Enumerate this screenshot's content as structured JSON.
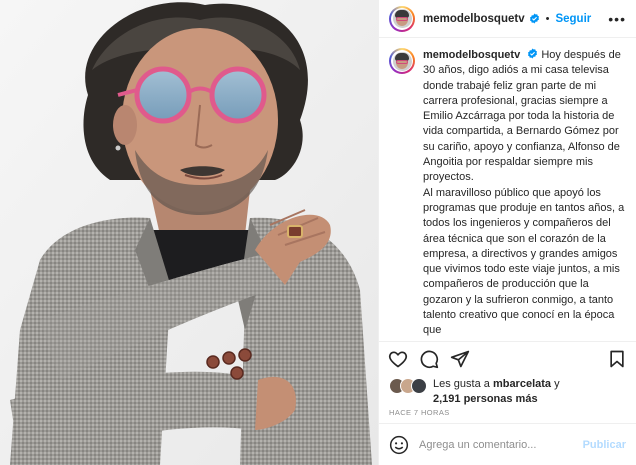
{
  "post": {
    "username": "memodelbosquetv",
    "follow_label": "Seguir",
    "more_label": "•••",
    "dot": "•",
    "caption_paragraphs": [
      "Hoy después de 30 años, digo adiós a mi casa televisa donde trabajé feliz gran parte de mi carrera profesional, gracias siempre a Emilio Azcárraga por toda la historia de vida compartida, a Bernardo Gómez por su cariño, apoyo y confianza, Alfonso de Angoitia por respaldar siempre mis proyectos.",
      "Al maravilloso público que apoyó los programas que produje en tantos años, a todos los ingenieros y compañeros del área técnica que son el corazón de la empresa, a directivos y grandes amigos que vivimos todo este viaje juntos, a mis compañeros de producción que la gozaron y la sufrieron conmigo, a tanto talento creativo que conocí en la época que"
    ],
    "likes": {
      "prefix": "Les gusta a",
      "first_user": "mbarcelata",
      "joiner": "y",
      "others": "2,191 personas más"
    },
    "time_ago": "HACE 7 HORAS",
    "comment": {
      "placeholder": "Agrega un comentario...",
      "publish_label": "Publicar"
    }
  },
  "icons": {
    "verified": "verified-badge-icon",
    "like": "heart-icon",
    "comment": "comment-bubble-icon",
    "share": "paper-plane-icon",
    "save": "bookmark-icon",
    "emoji": "smiley-icon"
  },
  "colors": {
    "accent": "#0095f6",
    "publish_disabled": "#b3dbff",
    "text": "#262626",
    "muted": "#8e8e8e"
  }
}
